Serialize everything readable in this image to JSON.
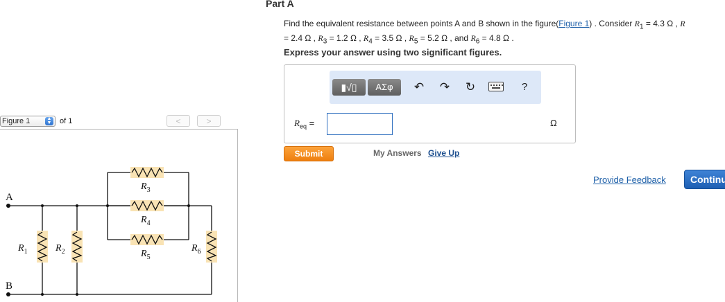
{
  "figure": {
    "select_value": "Figure 1",
    "of_label": "of 1",
    "prev_glyph": "<",
    "next_glyph": ">",
    "circuit": {
      "nodes": [
        "A",
        "B"
      ],
      "resistor_labels": {
        "R1": "R1",
        "R2": "R2",
        "R3": "R3",
        "R4": "R4",
        "R5": "R5",
        "R6": "R6"
      }
    }
  },
  "question": {
    "part_title": "Part A",
    "line1_prefix": "Find the equivalent resistance between points A and B shown in the figure(",
    "figure_link": "Figure 1",
    "line1_suffix": ") . Consider ",
    "r1_sym": "R",
    "r1_sub": "1",
    "r1_val": " = 4.3 Ω , ",
    "r2_sym": "R",
    "line2_r2_val": "= 2.4 Ω , ",
    "r3_sym": "R",
    "r3_sub": "3",
    "r3_val": " = 1.2 Ω , ",
    "r4_sym": "R",
    "r4_sub": "4",
    "r4_val": " = 3.5 Ω , ",
    "r5_sym": "R",
    "r5_sub": "5",
    "r5_val": " = 5.2 Ω , and ",
    "r6_sym": "R",
    "r6_sub": "6",
    "r6_val": " = 4.8 Ω ."
  },
  "instruction": "Express your answer using two significant figures.",
  "toolbar": {
    "templates_glyph": "▮√▯",
    "symbols_label": "ΑΣφ",
    "undo_glyph": "↶",
    "redo_glyph": "↷",
    "reset_glyph": "↻",
    "help_glyph": "?"
  },
  "answer": {
    "label_sym": "R",
    "label_sub": "eq",
    "label_eq": " =",
    "value": "",
    "unit": "Ω"
  },
  "actions": {
    "submit_label": "Submit",
    "my_answers_label": "My Answers",
    "give_up_label": "Give Up",
    "feedback_label": "Provide Feedback",
    "continue_label": "Continue"
  },
  "colors": {
    "submit": "#f28c1e",
    "continue": "#2a6fc4",
    "link": "#1d5fa8",
    "resistor_highlight": "#f9e3b4",
    "toolbar_bg": "#dde8f8"
  }
}
